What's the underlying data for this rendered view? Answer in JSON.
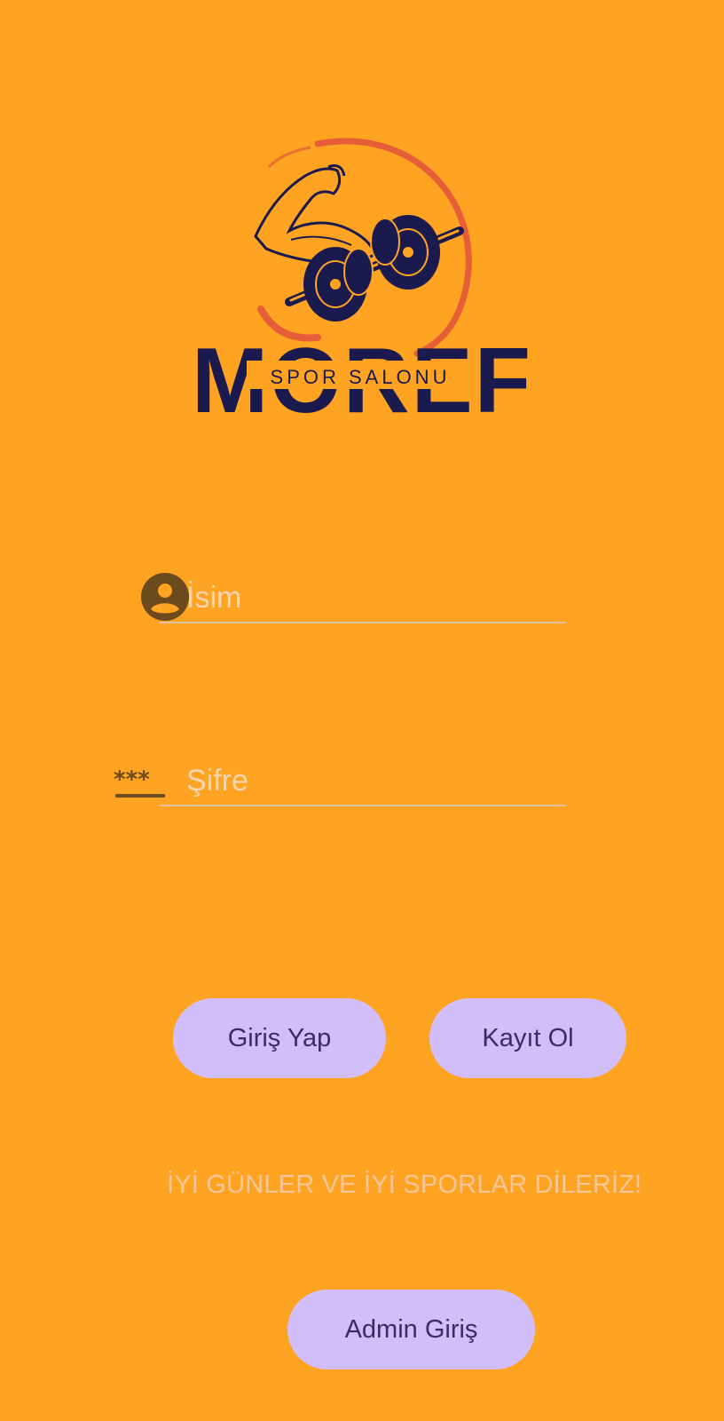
{
  "logo": {
    "wordmark": "MOREF",
    "subtitle": "SPOR SALONU",
    "colors": {
      "navy": "#1B1A4E",
      "ring": "#E2573A"
    }
  },
  "form": {
    "username": {
      "placeholder": "İsim",
      "value": "",
      "icon": "person-circle-icon"
    },
    "password": {
      "placeholder": "Şifre",
      "value": "",
      "icon": "password-icon"
    }
  },
  "buttons": {
    "login": "Giriş Yap",
    "signup": "Kayıt Ol",
    "admin": "Admin Giriş"
  },
  "message": "İYİ GÜNLER VE İYİ SPORLAR DİLERİZ!",
  "colors": {
    "background": "#FFA322",
    "button_bg": "#D2BEFB",
    "button_text": "#3E2A66",
    "icon": "#6B4A1E"
  }
}
